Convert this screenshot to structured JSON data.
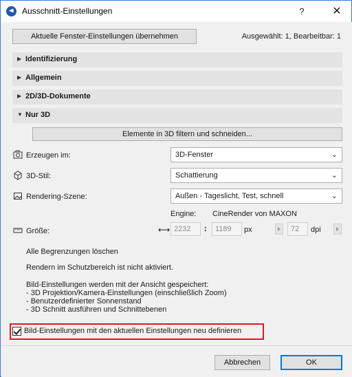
{
  "window": {
    "title": "Ausschnitt-Einstellungen",
    "help": "?",
    "close": "✕"
  },
  "top": {
    "apply_button": "Aktuelle Fenster-Einstellungen übernehmen",
    "status": "Ausgewählt: 1, Bearbeitbar: 1"
  },
  "sections": [
    {
      "label": "Identifizierung",
      "expanded": false
    },
    {
      "label": "Allgemein",
      "expanded": false
    },
    {
      "label": "2D/3D-Dokumente",
      "expanded": false
    },
    {
      "label": "Nur 3D",
      "expanded": true
    }
  ],
  "only3d": {
    "filter_button": "Elemente in 3D filtern und schneiden...",
    "rows": [
      {
        "label": "Erzeugen im:",
        "value": "3D-Fenster",
        "icon": "camera-icon"
      },
      {
        "label": "3D-Stil:",
        "value": "Schattierung",
        "icon": "cube-icon"
      },
      {
        "label": "Rendering-Szene:",
        "value": "Außen - Tageslicht, Test, schnell",
        "icon": "image-icon"
      }
    ],
    "engine_label": "Engine:",
    "engine_value": "CineRender von MAXON",
    "size_label": "Größe:",
    "width": "2232",
    "height": "1189",
    "px_unit": "px",
    "dpi": "72",
    "dpi_unit": "dpi",
    "clear_bounds": "Alle Begrenzungen löschen",
    "marquee_note": "Rendern im Schutzbereich ist nicht aktiviert.",
    "saved_intro": "Bild-Einstellungen werden mit der Ansicht gespeichert:",
    "saved_items": [
      "- 3D Projektion/Kamera-Einstellungen (einschließlich Zoom)",
      "- Benutzerdefinierter Sonnenstand",
      "- 3D Schnitt ausführen und Schnittebenen"
    ],
    "redefine_checkbox": "Bild-Einstellungen mit den aktuellen Einstellungen neu definieren",
    "redefine_checked": true
  },
  "footer": {
    "cancel": "Abbrechen",
    "ok": "OK"
  },
  "colors": {
    "accent": "#0078d7",
    "highlight": "#e81123"
  }
}
